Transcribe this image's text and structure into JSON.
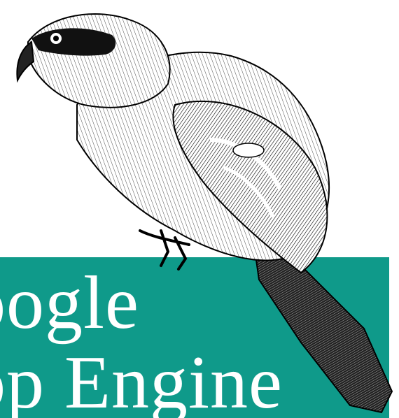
{
  "cover": {
    "title_line1": "oogle",
    "title_line2": "op Engine",
    "band_color": "#0f9a8a",
    "illustration": "shrike-bird-engraving"
  }
}
